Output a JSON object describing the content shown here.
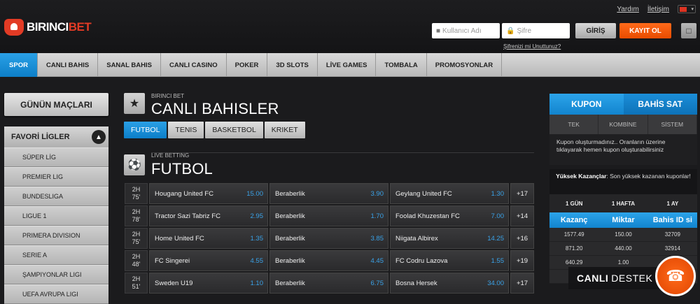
{
  "header": {
    "logo_main": "BIRINCI",
    "logo_accent": "BET",
    "links": [
      "Yardım",
      "İletişim"
    ],
    "username_placeholder": "Kullanıcı Adı",
    "password_placeholder": "Şifre",
    "login_label": "GİRİŞ",
    "register_label": "KAYIT OL",
    "forgot_label": "Şifrenizi mi Unuttunuz?",
    "accent_color": "#0d7fc8",
    "register_color": "#ff6a1a"
  },
  "nav": {
    "items": [
      {
        "label": "SPOR",
        "active": true
      },
      {
        "label": "CANLI BAHIS"
      },
      {
        "label": "SANAL BAHIS"
      },
      {
        "label": "CANLI CASINO"
      },
      {
        "label": "POKER"
      },
      {
        "label": "3D SLOTS"
      },
      {
        "label": "LİVE GAMES"
      },
      {
        "label": "TOMBALA"
      },
      {
        "label": "PROMOSYONLAR"
      }
    ]
  },
  "left": {
    "gunun_label": "GÜNÜN MAÇLARI",
    "favori_label": "FAVORİ LİGLER",
    "leagues": [
      "SÜPER LİG",
      "PREMIER LIG",
      "BUNDESLIGA",
      "LIGUE 1",
      "PRIMERA DIVISION",
      "SERIE A",
      "ŞAMPIYONLAR LIGI",
      "UEFA AVRUPA LIGI"
    ]
  },
  "center": {
    "section_small": "BIRINCI BET",
    "section_title": "CANLI BAHISLER",
    "tabs": [
      {
        "label": "FUTBOL",
        "active": true
      },
      {
        "label": "TENIS"
      },
      {
        "label": "BASKETBOL"
      },
      {
        "label": "KRIKET"
      }
    ],
    "live_small": "LIVE BETTING",
    "live_title": "FUTBOL",
    "matches": [
      {
        "period": "2H",
        "minute": "75'",
        "home": "Hougang United FC",
        "home_odd": "15.00",
        "draw": "Beraberlik",
        "draw_odd": "3.90",
        "away": "Geylang United FC",
        "away_odd": "1.30",
        "more": "+17"
      },
      {
        "period": "2H",
        "minute": "78'",
        "home": "Tractor Sazi Tabriz FC",
        "home_odd": "2.95",
        "draw": "Beraberlik",
        "draw_odd": "1.70",
        "away": "Foolad Khuzestan FC",
        "away_odd": "7.00",
        "more": "+14"
      },
      {
        "period": "2H",
        "minute": "75'",
        "home": "Home United FC",
        "home_odd": "1.35",
        "draw": "Beraberlik",
        "draw_odd": "3.85",
        "away": "Niigata Albirex",
        "away_odd": "14.25",
        "more": "+16"
      },
      {
        "period": "2H",
        "minute": "48'",
        "home": "FC Singerei",
        "home_odd": "4.55",
        "draw": "Beraberlik",
        "draw_odd": "4.45",
        "away": "FC Codru Lazova",
        "away_odd": "1.55",
        "more": "+19"
      },
      {
        "period": "2H",
        "minute": "51'",
        "home": "Sweden U19",
        "home_odd": "1.10",
        "draw": "Beraberlik",
        "draw_odd": "6.75",
        "away": "Bosna Hersek",
        "away_odd": "34.00",
        "more": "+17"
      }
    ]
  },
  "coupon": {
    "tab_kupon": "KUPON",
    "tab_bahis_sat": "BAHİS SAT",
    "sub_tabs": [
      "TEK",
      "KOMBİNE",
      "SİSTEM"
    ],
    "empty_message": "Kupon oluşturmadınız.. Oranların üzerine tıklayarak hemen kupon oluşturabilirsiniz",
    "yuksek_title": "Yüksek Kazançlar",
    "yuksek_text": ": Son yüksek kazanan kuponlar!",
    "periods": [
      "1 GÜN",
      "1 HAFTA",
      "1 AY"
    ],
    "columns": [
      "Kazanç",
      "Miktar",
      "Bahis ID si"
    ],
    "rows": [
      [
        "1577.49",
        "150.00",
        "32709"
      ],
      [
        "871.20",
        "440.00",
        "32914"
      ],
      [
        "640.29",
        "1.00",
        ""
      ],
      [
        "",
        "",
        ""
      ]
    ]
  },
  "support": {
    "canli": "CANLI",
    "destek": "DESTEK"
  }
}
